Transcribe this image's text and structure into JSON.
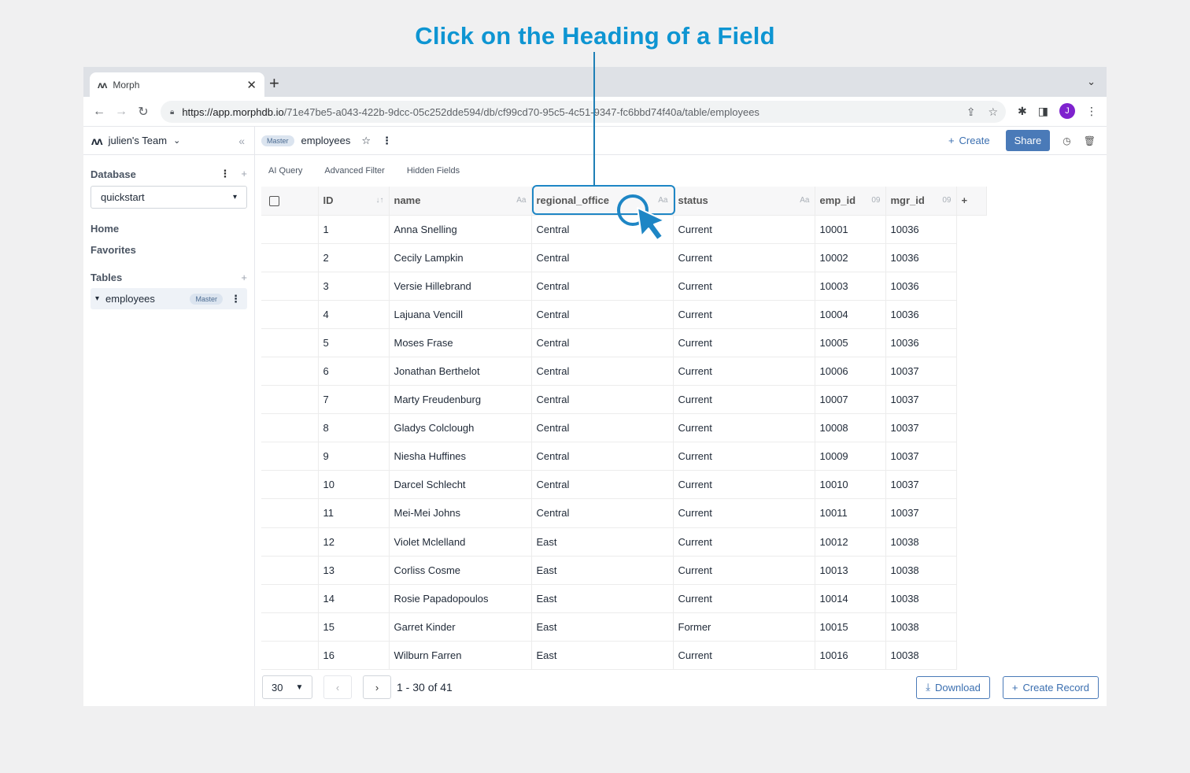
{
  "headline": "Click on the Heading of a Field",
  "browser": {
    "tab_title": "Morph",
    "url_host": "https://app.morphdb.io",
    "url_path": "/71e47be5-a043-422b-9dcc-05c252dde594/db/cf99cd70-95c5-4c51-9347-fc6bbd74f40a/table/employees",
    "avatar_letter": "J"
  },
  "sidebar": {
    "team_name": "julien's Team",
    "database_heading": "Database",
    "database_selected": "quickstart",
    "home": "Home",
    "favorites": "Favorites",
    "tables_heading": "Tables",
    "table_item": "employees",
    "table_badge": "Master"
  },
  "topbar": {
    "badge": "Master",
    "table_name": "employees",
    "create_label": "Create",
    "share_label": "Share"
  },
  "subtabs": [
    "AI Query",
    "Advanced Filter",
    "Hidden Fields"
  ],
  "columns": [
    {
      "name": "ID",
      "type": "↓↑"
    },
    {
      "name": "name",
      "type": "Aa"
    },
    {
      "name": "regional_office",
      "type": "Aa"
    },
    {
      "name": "status",
      "type": "Aa"
    },
    {
      "name": "emp_id",
      "type": "09"
    },
    {
      "name": "mgr_id",
      "type": "09"
    }
  ],
  "rows": [
    [
      "1",
      "Anna Snelling",
      "Central",
      "Current",
      "10001",
      "10036"
    ],
    [
      "2",
      "Cecily Lampkin",
      "Central",
      "Current",
      "10002",
      "10036"
    ],
    [
      "3",
      "Versie Hillebrand",
      "Central",
      "Current",
      "10003",
      "10036"
    ],
    [
      "4",
      "Lajuana Vencill",
      "Central",
      "Current",
      "10004",
      "10036"
    ],
    [
      "5",
      "Moses Frase",
      "Central",
      "Current",
      "10005",
      "10036"
    ],
    [
      "6",
      "Jonathan Berthelot",
      "Central",
      "Current",
      "10006",
      "10037"
    ],
    [
      "7",
      "Marty Freudenburg",
      "Central",
      "Current",
      "10007",
      "10037"
    ],
    [
      "8",
      "Gladys Colclough",
      "Central",
      "Current",
      "10008",
      "10037"
    ],
    [
      "9",
      "Niesha Huffines",
      "Central",
      "Current",
      "10009",
      "10037"
    ],
    [
      "10",
      "Darcel Schlecht",
      "Central",
      "Current",
      "10010",
      "10037"
    ],
    [
      "11",
      "Mei-Mei Johns",
      "Central",
      "Current",
      "10011",
      "10037"
    ],
    [
      "12",
      "Violet Mclelland",
      "East",
      "Current",
      "10012",
      "10038"
    ],
    [
      "13",
      "Corliss Cosme",
      "East",
      "Current",
      "10013",
      "10038"
    ],
    [
      "14",
      "Rosie Papadopoulos",
      "East",
      "Current",
      "10014",
      "10038"
    ],
    [
      "15",
      "Garret Kinder",
      "East",
      "Former",
      "10015",
      "10038"
    ],
    [
      "16",
      "Wilburn Farren",
      "East",
      "Current",
      "10016",
      "10038"
    ]
  ],
  "footer": {
    "page_size": "30",
    "page_info": "1 - 30 of 41",
    "download_label": "Download",
    "create_record_label": "Create Record"
  },
  "colors": {
    "headline": "#0e95d2",
    "accent": "#4a7ab8",
    "highlight": "#1e86c5"
  }
}
